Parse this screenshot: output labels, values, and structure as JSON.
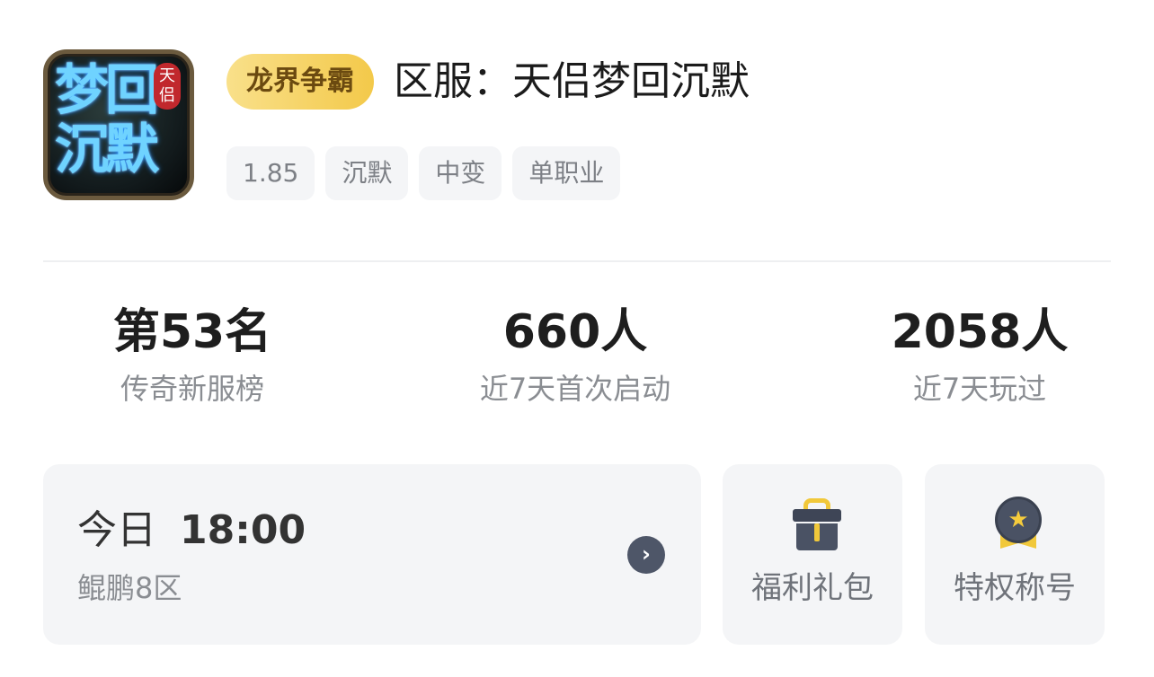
{
  "app": {
    "icon_text": "梦回沉默",
    "icon_seal": "天侣",
    "badge": "龙界争霸",
    "title": "区服：天侣梦回沉默",
    "tags": [
      "1.85",
      "沉默",
      "中变",
      "单职业"
    ]
  },
  "stats": [
    {
      "value": "第53名",
      "label": "传奇新服榜"
    },
    {
      "value": "660人",
      "label": "近7天首次启动"
    },
    {
      "value": "2058人",
      "label": "近7天玩过"
    }
  ],
  "schedule": {
    "day": "今日",
    "time": "18:00",
    "zone": "鲲鹏8区",
    "arrow_icon": "chevron-right-icon"
  },
  "actions": {
    "gift": {
      "label": "福利礼包",
      "icon": "gift-icon"
    },
    "privilege": {
      "label": "特权称号",
      "icon": "medal-icon"
    }
  },
  "colors": {
    "badge_bg": "#f3c94a",
    "card_bg": "#f4f5f7",
    "accent_dark": "#4e5668",
    "gold": "#f1c83a"
  }
}
